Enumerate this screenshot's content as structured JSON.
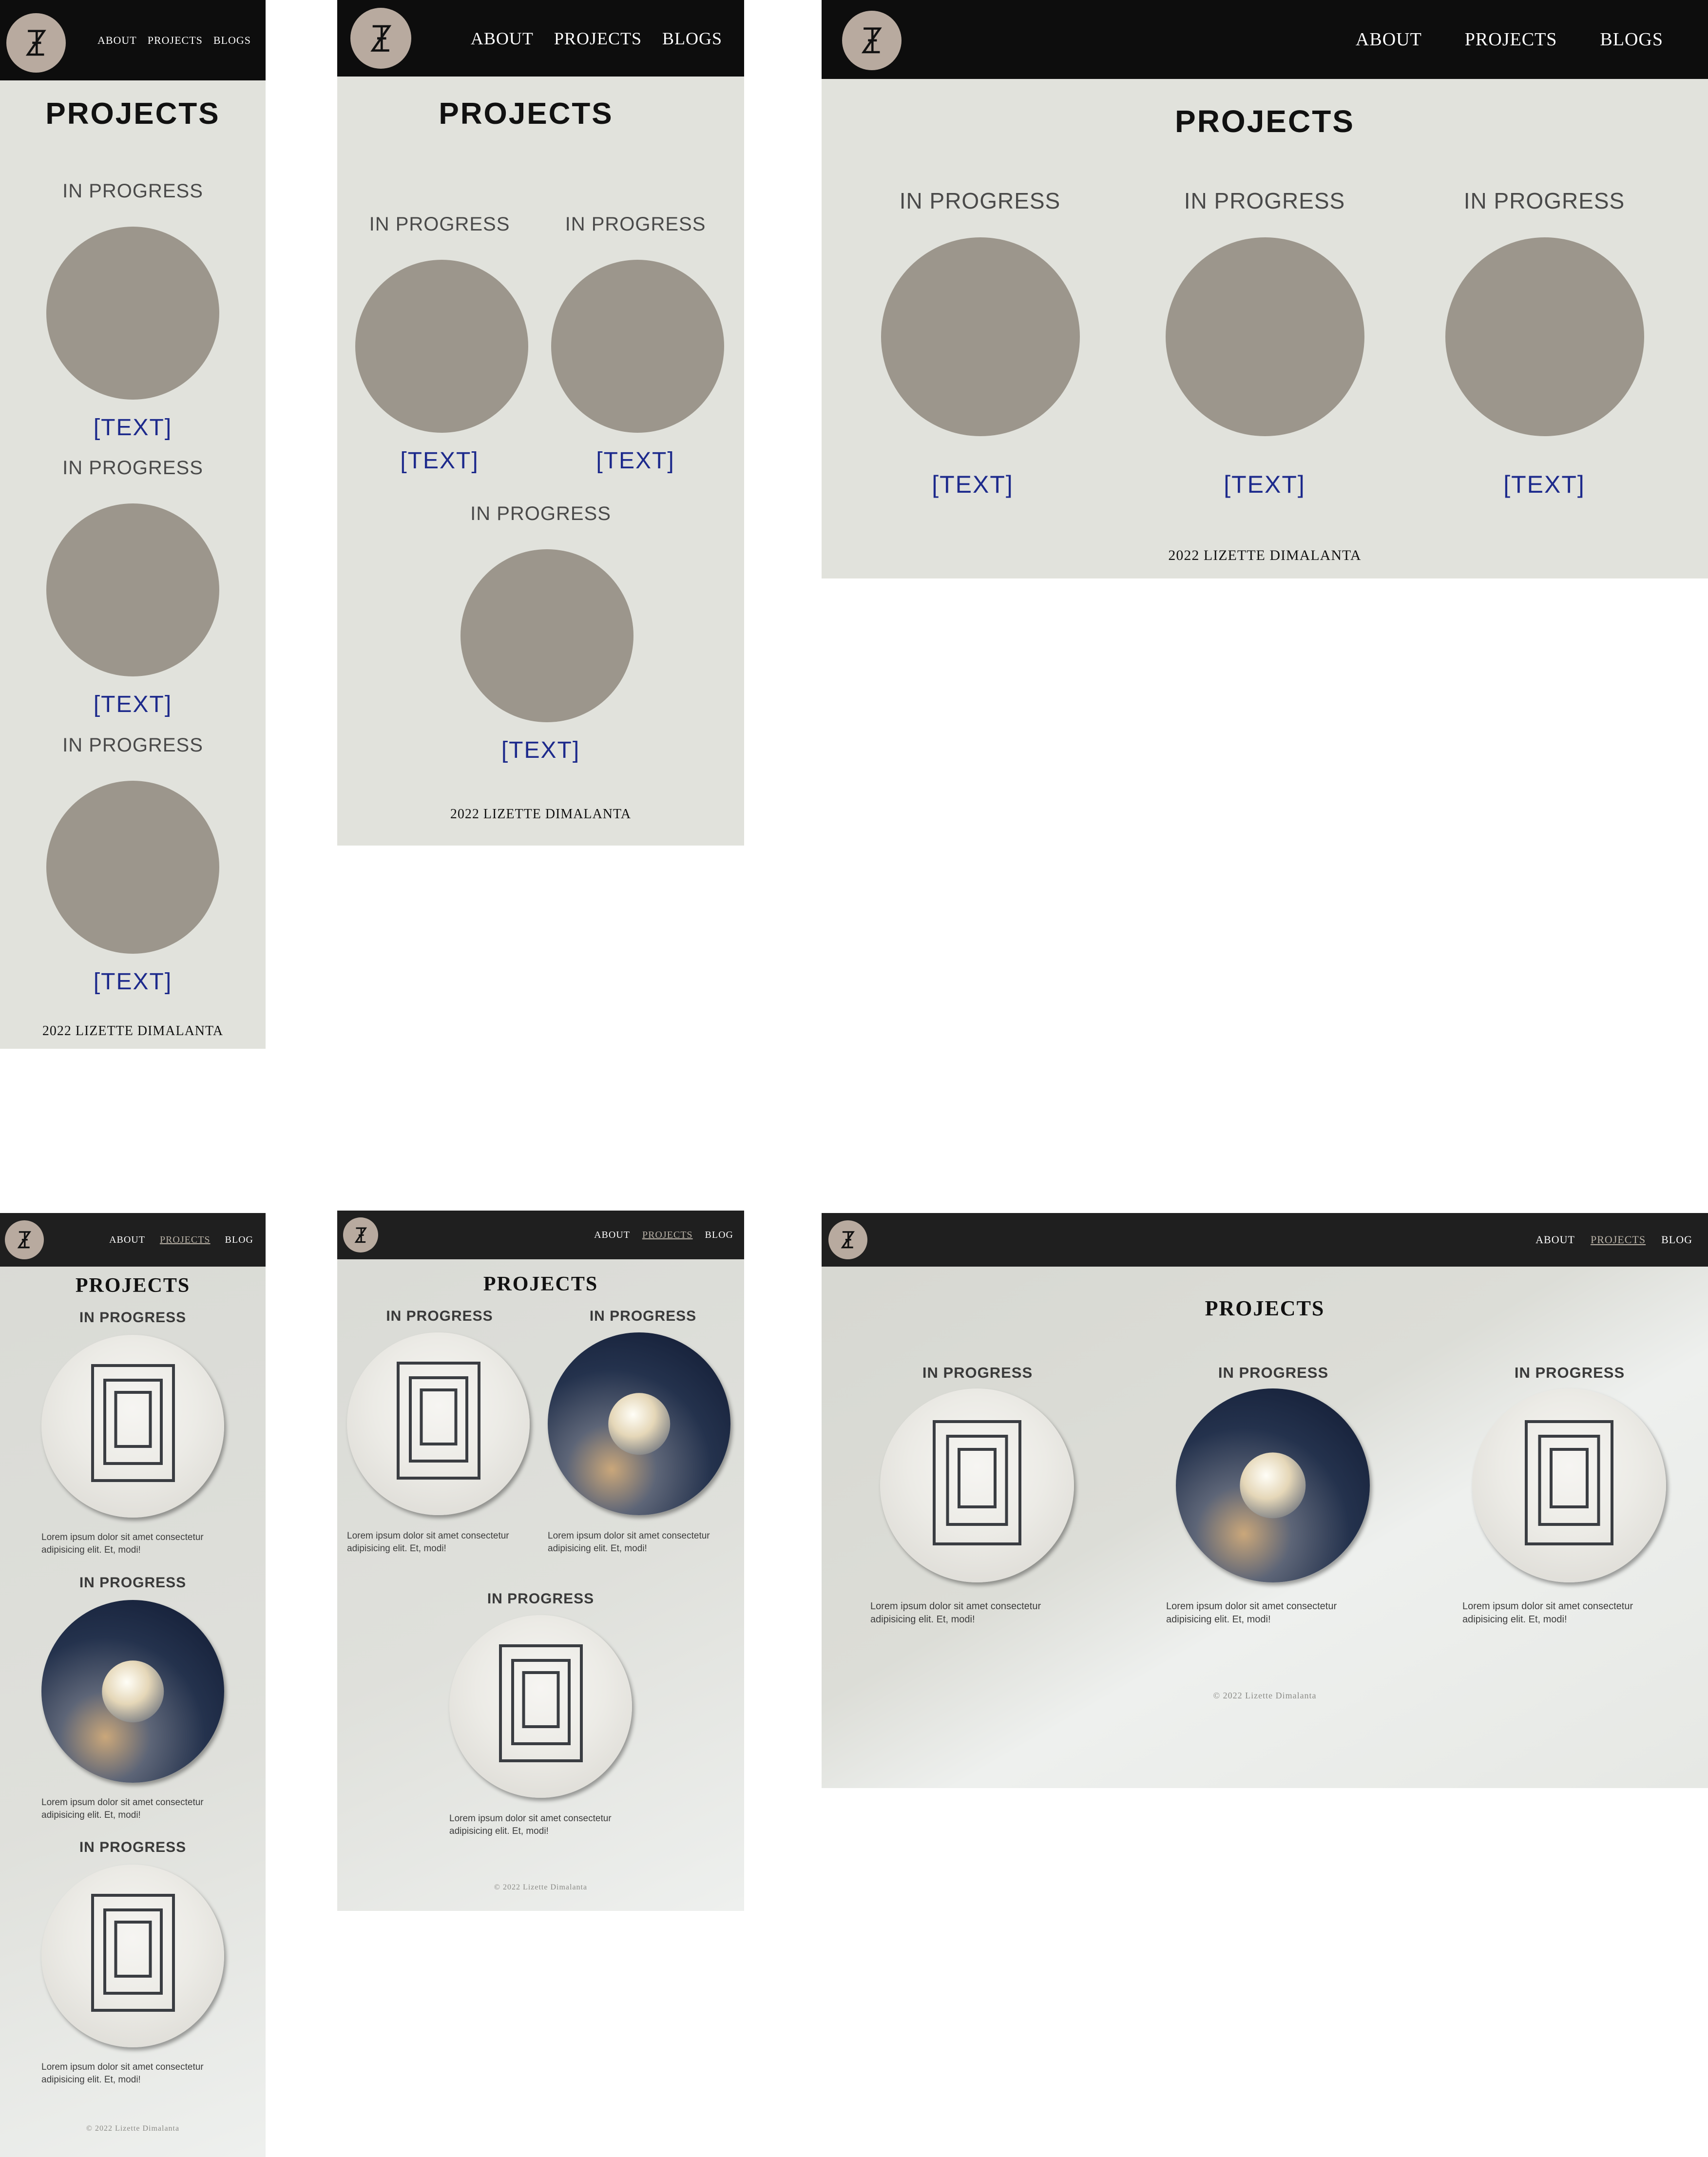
{
  "wireframes": {
    "nav": {
      "about": "ABOUT",
      "projects": "PROJECTS",
      "blogs": "BLOGS"
    },
    "title": "PROJECTS",
    "card_label": "IN PROGRESS",
    "card_text": "[TEXT]",
    "footer": "2022 LIZETTE DIMALANTA"
  },
  "designs": {
    "nav": {
      "about": "ABOUT",
      "projects": "PROJECTS",
      "blog": "BLOG"
    },
    "title": "PROJECTS",
    "card_label": "IN PROGRESS",
    "lorem": "Lorem ipsum dolor sit amet consectetur adipisicing elit. Et, modi!",
    "footer": "© 2022 Lizette Dimalanta"
  },
  "colors": {
    "nav_bg_wire": "#0d0d0d",
    "nav_bg_design": "#1f1f1f",
    "page_bg": "#e1e2dc",
    "circle_fill": "#9c968c",
    "link_text": "#1d2a8c",
    "logo_bg": "#b8aa9f"
  },
  "icons": {
    "logo": "lz-monogram-logo"
  }
}
